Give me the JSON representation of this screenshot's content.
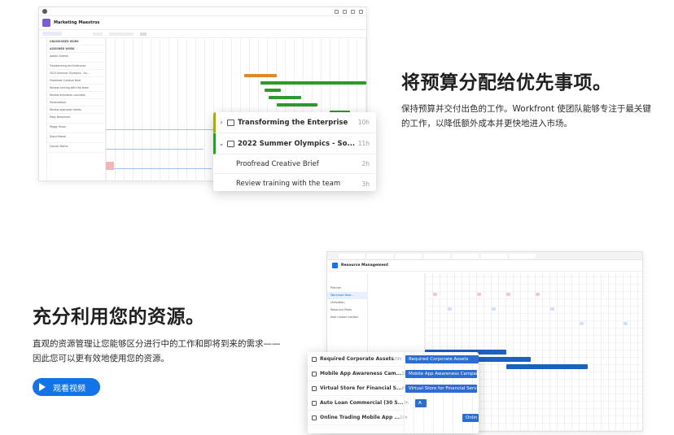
{
  "section1": {
    "heading": "将预算分配给优先事项。",
    "body": "保持预算并交付出色的工作。Workfront 使团队能够专注于最关键的工作，以降低额外成本并更快地进入市场。",
    "screenshot": {
      "project_title": "Marketing Maestros",
      "left_header": "UNASSIGNED WORK",
      "left_sub": "ASSIGNED WORK",
      "rows": [
        "Jordan Greene",
        "Transforming the Enterprise",
        "2022 Summer Olympics - So...",
        "Proofread Creative Brief",
        "Review training with the team",
        "Review animation concepts",
        "Presentation",
        "Review approved tickets",
        "Mary Beaumont",
        "Peggy Olson",
        "Diana Reese",
        "Connor Martin"
      ]
    },
    "panel": {
      "rows": [
        {
          "chevron": "›",
          "label": "Transforming the Enterprise",
          "hours": "10h"
        },
        {
          "chevron": "⌄",
          "label": "2022 Summer Olympics - So...",
          "hours": "11h"
        },
        {
          "chevron": "",
          "label": "Proofread Creative Brief",
          "hours": "2h"
        },
        {
          "chevron": "",
          "label": "Review training with the team",
          "hours": "3h"
        }
      ]
    }
  },
  "section2": {
    "heading": "充分利用您的资源。",
    "body": "直观的资源管理让您能够区分进行中的工作和即将到来的需求——因此您可以更有效地使用您的资源。",
    "button_label": "观看视频",
    "screenshot": {
      "title": "Resource Management",
      "nav": [
        "Planner",
        "Workload Bala...",
        "Utilization",
        "Resource Pools",
        "Add custom section"
      ]
    },
    "panel": {
      "rows": [
        {
          "label": "Required Corporate Assets",
          "hours": "29h"
        },
        {
          "label": "Mobile App Awareness Cam...",
          "hours": "10h"
        },
        {
          "label": "Virtual Store for Financial S...",
          "hours": "80h"
        },
        {
          "label": "Auto Loan Commercial (30 S...",
          "hours": "2h"
        },
        {
          "label": "Online Trading Mobile App ...",
          "hours": "10h"
        }
      ],
      "bars": [
        "Required Corporate Assets",
        "Mobile App Awareness Campaign",
        "Virtual Store for Financial Serv",
        "A",
        "Onlin"
      ]
    }
  },
  "colors": {
    "accent": "#1473e6",
    "green": "#2d9a2d",
    "olive": "#a7a71e",
    "orange": "#e08a1e"
  }
}
